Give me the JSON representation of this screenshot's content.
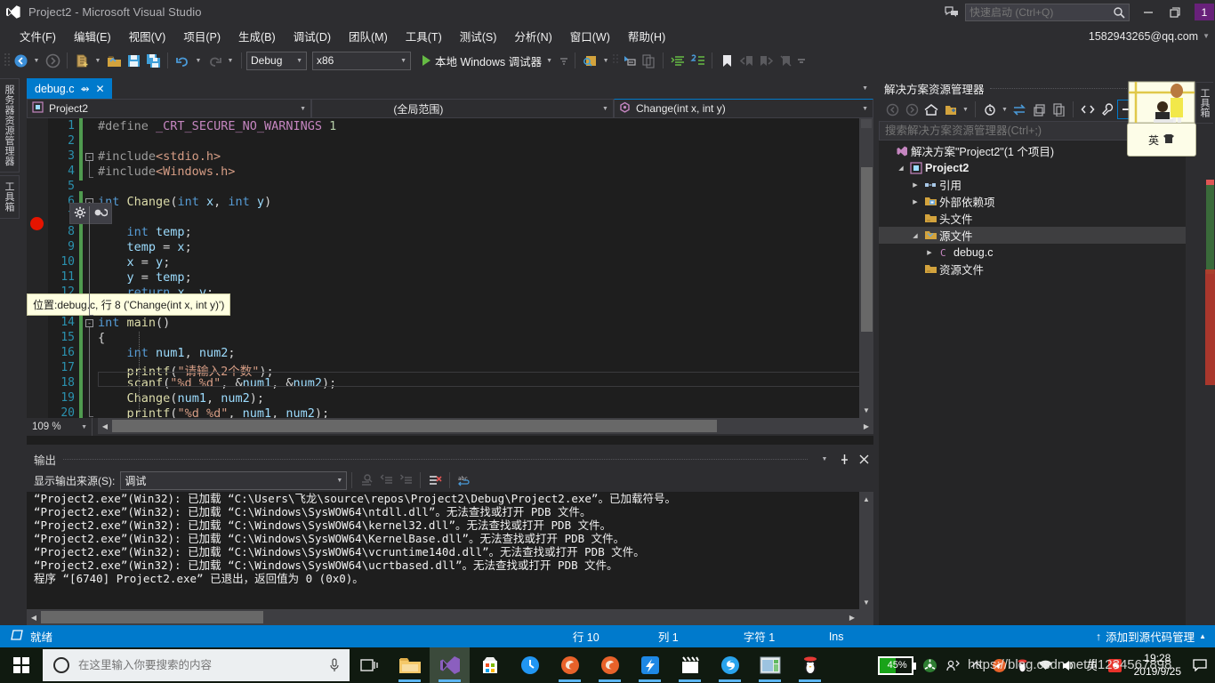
{
  "titlebar": {
    "title": "Project2 - Microsoft Visual Studio",
    "logo_icon": "visual-studio-logo-icon",
    "feedback_icon": "send-feedback-icon",
    "quicklaunch_placeholder": "快速启动 (Ctrl+Q)",
    "quicklaunch_value": "",
    "search_icon": "search-icon",
    "minimize_icon": "minimize-icon",
    "restore_icon": "restore-icon",
    "close_icon": "close-icon",
    "notification_count": "1"
  },
  "menubar": {
    "items": [
      {
        "label": "文件(F)"
      },
      {
        "label": "编辑(E)"
      },
      {
        "label": "视图(V)"
      },
      {
        "label": "项目(P)"
      },
      {
        "label": "生成(B)"
      },
      {
        "label": "调试(D)"
      },
      {
        "label": "团队(M)"
      },
      {
        "label": "工具(T)"
      },
      {
        "label": "测试(S)"
      },
      {
        "label": "分析(N)"
      },
      {
        "label": "窗口(W)"
      },
      {
        "label": "帮助(H)"
      }
    ],
    "account": "1582943265@qq.com",
    "account_caret_icon": "chevron-down-icon"
  },
  "toolbar": {
    "nav_back_icon": "navigate-back-icon",
    "nav_forward_icon": "navigate-forward-icon",
    "new_project_icon": "new-project-icon",
    "open_file_icon": "open-file-icon",
    "save_icon": "save-icon",
    "save_all_icon": "save-all-icon",
    "undo_icon": "undo-icon",
    "redo_icon": "redo-icon",
    "config_value": "Debug",
    "platform_value": "x86",
    "run_label": "本地 Windows 调试器",
    "run_icon": "play-icon",
    "find_icon": "find-in-files-icon",
    "step_into_icon": "step-into-icon",
    "copy_icon": "copy-icon",
    "indent_icon": "indent-icon",
    "comment_icon": "comment-icon",
    "bookmark_icon": "bookmark-icon",
    "prev_bookmark_icon": "previous-bookmark-icon",
    "next_bookmark_icon": "next-bookmark-icon",
    "clear_bookmark_icon": "clear-bookmark-icon",
    "overflow_icon": "toolbar-overflow-icon"
  },
  "left_tabs": [
    {
      "label": "服务器资源管理器",
      "name": "server-explorer"
    },
    {
      "label": "工具箱",
      "name": "toolbox"
    }
  ],
  "editor": {
    "tab_label": "debug.c",
    "tab_pin_icon": "pin-icon",
    "tab_close_icon": "close-icon",
    "project_combo": "Project2",
    "project_icon": "project-icon",
    "scope_combo": "(全局范围)",
    "member_combo": "Change(int x, int y)",
    "member_icon": "method-icon",
    "caret_icon": "chevron-down-icon",
    "zoom_level": "109 %",
    "lines": [
      {
        "n": 1,
        "html": "<span class=\"pre\">#define</span> <span class=\"macro-sq\">_CRT_SECURE_NO_WARNINGS</span> <span class=\"num\">1</span>"
      },
      {
        "n": 2,
        "html": ""
      },
      {
        "n": 3,
        "html": "<span class=\"pre\">#include</span><span class=\"str\">&lt;stdio.h&gt;</span>"
      },
      {
        "n": 4,
        "html": "<span class=\"pre\">#include</span><span class=\"str\">&lt;Windows.h&gt;</span>"
      },
      {
        "n": 5,
        "html": ""
      },
      {
        "n": 6,
        "html": "<span class=\"kw\">int</span> <span class=\"fn\">Change</span>(<span class=\"kw\">int</span> <span class=\"ident\">x</span>, <span class=\"kw\">int</span> <span class=\"ident\">y</span>)"
      },
      {
        "n": 7,
        "html": "{"
      },
      {
        "n": 8,
        "html": "    <span class=\"kw\">int</span> <span class=\"ident\">temp</span>;"
      },
      {
        "n": 9,
        "html": "    <span class=\"ident\">temp</span> = <span class=\"ident\">x</span>;"
      },
      {
        "n": 10,
        "html": "    <span class=\"ident\">x</span> = <span class=\"ident\">y</span>;"
      },
      {
        "n": 11,
        "html": "    <span class=\"ident\">y</span> = <span class=\"ident\">temp</span>;"
      },
      {
        "n": 12,
        "html": "    <span class=\"kw\">return</span> <span class=\"ident\">x</span>, <span class=\"ident\">y</span>;"
      },
      {
        "n": 13,
        "html": "}"
      },
      {
        "n": 14,
        "html": "<span class=\"kw\">int</span> <span class=\"fn\">main</span>()"
      },
      {
        "n": 15,
        "html": "{"
      },
      {
        "n": 16,
        "html": "    <span class=\"kw\">int</span> <span class=\"ident\">num1</span>, <span class=\"ident\">num2</span>;"
      },
      {
        "n": 17,
        "html": "    <span class=\"fn\">printf</span>(<span class=\"str\">\"请输入2个数\"</span>);"
      },
      {
        "n": 18,
        "html": "    <span class=\"fn\">scanf</span>(<span class=\"str\">\"%d %d\"</span>, &amp;<span class=\"ident\">num1</span>, &amp;<span class=\"ident\">num2</span>);"
      },
      {
        "n": 19,
        "html": "    <span class=\"fn\">Change</span>(<span class=\"ident\">num1</span>, <span class=\"ident\">num2</span>);"
      },
      {
        "n": 20,
        "html": "    <span class=\"fn\">printf</span>(<span class=\"str\">\"%d %d\"</span>, <span class=\"ident\">num1</span>, <span class=\"ident\">num2</span>);"
      }
    ],
    "breakpoint_tooltip": "位置:debug.c, 行 8 ('Change(int x, int y)')",
    "breakpoint_settings_icon": "gear-icon",
    "breakpoint_condition_icon": "breakpoint-condition-icon",
    "breakpoint_icon": "breakpoint-icon"
  },
  "output": {
    "panel_title": "输出",
    "source_label": "显示输出来源(S):",
    "source_value": "调试",
    "caret_icon": "chevron-down-icon",
    "dropdown_icon": "panel-dropdown-icon",
    "pin_icon": "pin-icon",
    "close_icon": "close-icon",
    "find_message_icon": "find-message-icon",
    "prev_icon": "previous-message-icon",
    "next_icon": "next-message-icon",
    "clear_icon": "clear-all-icon",
    "wrap_icon": "word-wrap-icon",
    "lines": [
      "“Project2.exe”(Win32): 已加载 “C:\\Users\\飞龙\\source\\repos\\Project2\\Debug\\Project2.exe”。已加载符号。",
      "“Project2.exe”(Win32): 已加载 “C:\\Windows\\SysWOW64\\ntdll.dll”。无法查找或打开 PDB 文件。",
      "“Project2.exe”(Win32): 已加载 “C:\\Windows\\SysWOW64\\kernel32.dll”。无法查找或打开 PDB 文件。",
      "“Project2.exe”(Win32): 已加载 “C:\\Windows\\SysWOW64\\KernelBase.dll”。无法查找或打开 PDB 文件。",
      "“Project2.exe”(Win32): 已加载 “C:\\Windows\\SysWOW64\\vcruntime140d.dll”。无法查找或打开 PDB 文件。",
      "“Project2.exe”(Win32): 已加载 “C:\\Windows\\SysWOW64\\ucrtbased.dll”。无法查找或打开 PDB 文件。",
      "程序 “[6740] Project2.exe” 已退出，返回值为 0 (0x0)。"
    ]
  },
  "solution_explorer": {
    "title": "解决方案资源管理器",
    "dropdown_icon": "panel-dropdown-icon",
    "pin_icon": "pin-icon",
    "close_icon": "close-icon",
    "toolbar": [
      {
        "name": "back-icon"
      },
      {
        "name": "forward-icon"
      },
      {
        "name": "home-icon"
      },
      {
        "name": "pending-changes-icon"
      },
      {
        "name": "chevron-down-icon"
      },
      {
        "name": "sync-with-active-document-icon"
      },
      {
        "name": "chevron-down-icon"
      },
      {
        "name": "refresh-icon"
      },
      {
        "name": "collapse-all-icon"
      },
      {
        "name": "show-all-files-icon"
      },
      {
        "name": "view-code-icon"
      },
      {
        "name": "properties-icon"
      },
      {
        "name": "preview-selected-items-icon"
      }
    ],
    "search_placeholder": "搜索解决方案资源管理器(Ctrl+;)",
    "search_value": "",
    "tree": [
      {
        "label": "解决方案\"Project2\"(1 个项目)",
        "twist": "",
        "icon": "solution-icon",
        "indent": 0,
        "selected": false
      },
      {
        "label": "Project2",
        "twist": "expanded",
        "icon": "cpp-project-icon",
        "indent": 1,
        "selected": false,
        "bold": true
      },
      {
        "label": "引用",
        "twist": "collapsed",
        "icon": "references-icon",
        "indent": 2,
        "selected": false
      },
      {
        "label": "外部依赖项",
        "twist": "collapsed",
        "icon": "external-dependencies-icon",
        "indent": 2,
        "selected": false
      },
      {
        "label": "头文件",
        "twist": "",
        "icon": "folder-icon",
        "indent": 2,
        "selected": false
      },
      {
        "label": "源文件",
        "twist": "expanded",
        "icon": "folder-open-icon",
        "indent": 2,
        "selected": true
      },
      {
        "label": "debug.c",
        "twist": "collapsed",
        "icon": "c-file-icon",
        "indent": 3,
        "selected": false
      },
      {
        "label": "资源文件",
        "twist": "",
        "icon": "folder-icon",
        "indent": 2,
        "selected": false
      }
    ]
  },
  "right_strip": {
    "tab_label": "工具箱"
  },
  "ime": {
    "mode": "英",
    "shirt_icon": "ime-skin-icon"
  },
  "vs_status": {
    "ready": "就绪",
    "ready_icon": "status-ready-icon",
    "line_label": "行 10",
    "col_label": "列 1",
    "char_label": "字符 1",
    "ins_label": "Ins",
    "source_control": "添加到源代码管理",
    "up_icon": "arrow-up-icon",
    "caret_icon": "chevron-up-icon"
  },
  "taskbar": {
    "start_icon": "windows-start-icon",
    "search_placeholder": "在这里输入你要搜索的内容",
    "search_value": "",
    "cortana_icon": "cortana-ring-icon",
    "mic_icon": "microphone-icon",
    "taskview_icon": "task-view-icon",
    "apps": [
      {
        "name": "file-explorer-icon",
        "running": true,
        "active": false
      },
      {
        "name": "visual-studio-icon",
        "running": true,
        "active": true
      },
      {
        "name": "microsoft-store-icon",
        "running": false,
        "active": false
      },
      {
        "name": "clock-app-icon",
        "running": false,
        "active": false
      },
      {
        "name": "firefox-icon",
        "running": true,
        "active": false
      },
      {
        "name": "firefox-icon",
        "running": true,
        "active": false
      },
      {
        "name": "thunder-download-icon",
        "running": true,
        "active": false
      },
      {
        "name": "video-player-icon",
        "running": true,
        "active": false
      },
      {
        "name": "sogou-input-icon",
        "running": true,
        "active": false
      },
      {
        "name": "window-app-icon",
        "running": true,
        "active": false
      },
      {
        "name": "qq-icon",
        "running": true,
        "active": false
      }
    ],
    "battery_percent": "45%",
    "battery_icon": "battery-icon",
    "tray": [
      {
        "name": "safety-shield-icon"
      },
      {
        "name": "share-user-icon"
      },
      {
        "name": "show-hidden-icons-icon"
      },
      {
        "name": "thunder-tray-icon"
      },
      {
        "name": "qq-tray-icon"
      },
      {
        "name": "network-icon"
      },
      {
        "name": "volume-icon"
      },
      {
        "name": "ime-indicator-icon"
      },
      {
        "name": "sogou-tray-icon"
      }
    ],
    "clock_time": "19:28",
    "clock_date": "2019/9/25",
    "notification_icon": "action-center-icon",
    "watermark": "https://blog.csdn.net/fl1234567898"
  }
}
